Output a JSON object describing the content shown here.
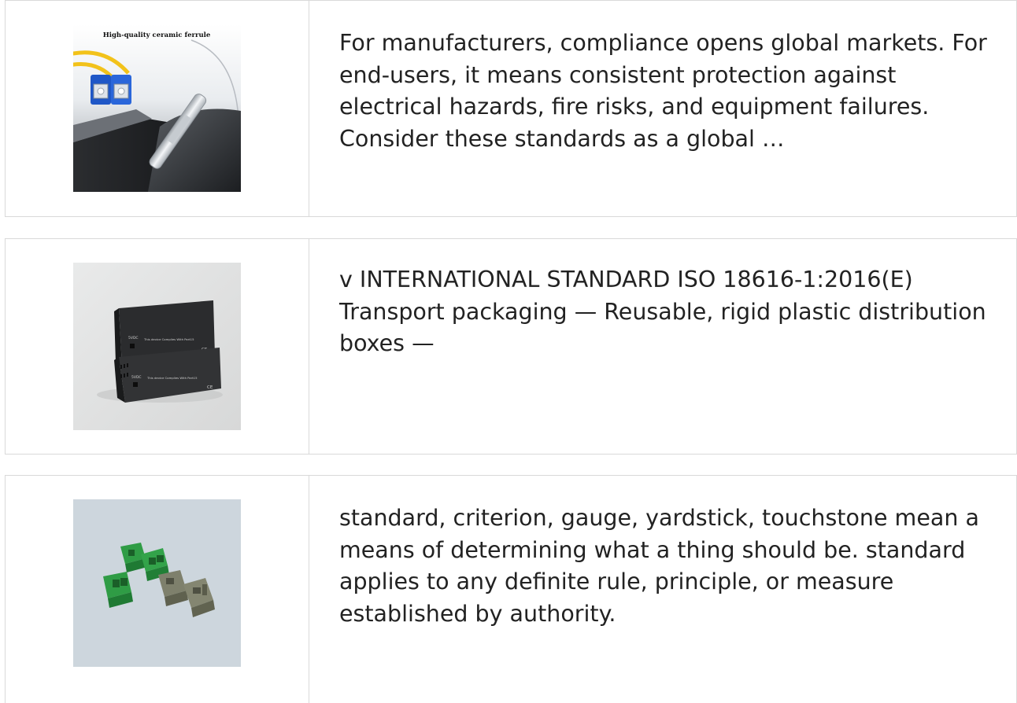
{
  "results": [
    {
      "image_alt": "Fiber optic SC connector with ceramic ferrule",
      "image_caption": "High-quality ceramic ferrule",
      "snippet": "For manufacturers, compliance opens global markets. For end-users, it means consistent protection against electrical hazards, fire risks, and equipment failures. Consider these standards as a global …"
    },
    {
      "image_alt": "Two black media converter boxes",
      "image_labels": [
        "5VDC",
        "This device Complies With Part15 of The Fcc Rules",
        "CE"
      ],
      "snippet": "v INTERNATIONAL STANDARD ISO 18616-1:2016(E) Transport packaging — Reusable, rigid plastic distribution boxes —"
    },
    {
      "image_alt": "Green and grey fiber optic adapters",
      "snippet": "standard, criterion, gauge, yardstick, touchstone mean a means of determining what a thing should be. standard applies to any definite rule, principle, or measure established by authority."
    }
  ]
}
